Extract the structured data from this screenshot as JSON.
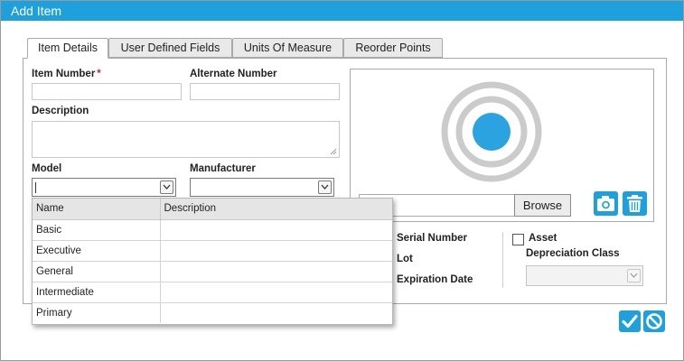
{
  "dialog": {
    "title": "Add Item"
  },
  "tabs": [
    {
      "label": "Item Details"
    },
    {
      "label": "User Defined Fields"
    },
    {
      "label": "Units Of Measure"
    },
    {
      "label": "Reorder Points"
    }
  ],
  "form": {
    "item_number_label": "Item Number",
    "required_marker": "*",
    "alternate_number_label": "Alternate Number",
    "description_label": "Description",
    "model_label": "Model",
    "manufacturer_label": "Manufacturer",
    "serial_number_label": "Serial Number",
    "lot_label": "Lot",
    "expiration_date_label": "Expiration Date",
    "asset_label": "Asset",
    "depreciation_class_label": "Depreciation Class"
  },
  "image": {
    "browse_label": "Browse"
  },
  "model_dropdown": {
    "columns": [
      "Name",
      "Description"
    ],
    "rows": [
      {
        "name": "Basic",
        "description": ""
      },
      {
        "name": "Executive",
        "description": ""
      },
      {
        "name": "General",
        "description": ""
      },
      {
        "name": "Intermediate",
        "description": ""
      },
      {
        "name": "Primary",
        "description": ""
      }
    ]
  },
  "icons": {
    "camera": "camera-icon",
    "trash": "trash-icon",
    "save": "checkmark-icon",
    "cancel": "cancel-icon",
    "placeholder": "image-placeholder-icon"
  },
  "colors": {
    "accent": "#1ea0dc",
    "required": "#e02020"
  }
}
